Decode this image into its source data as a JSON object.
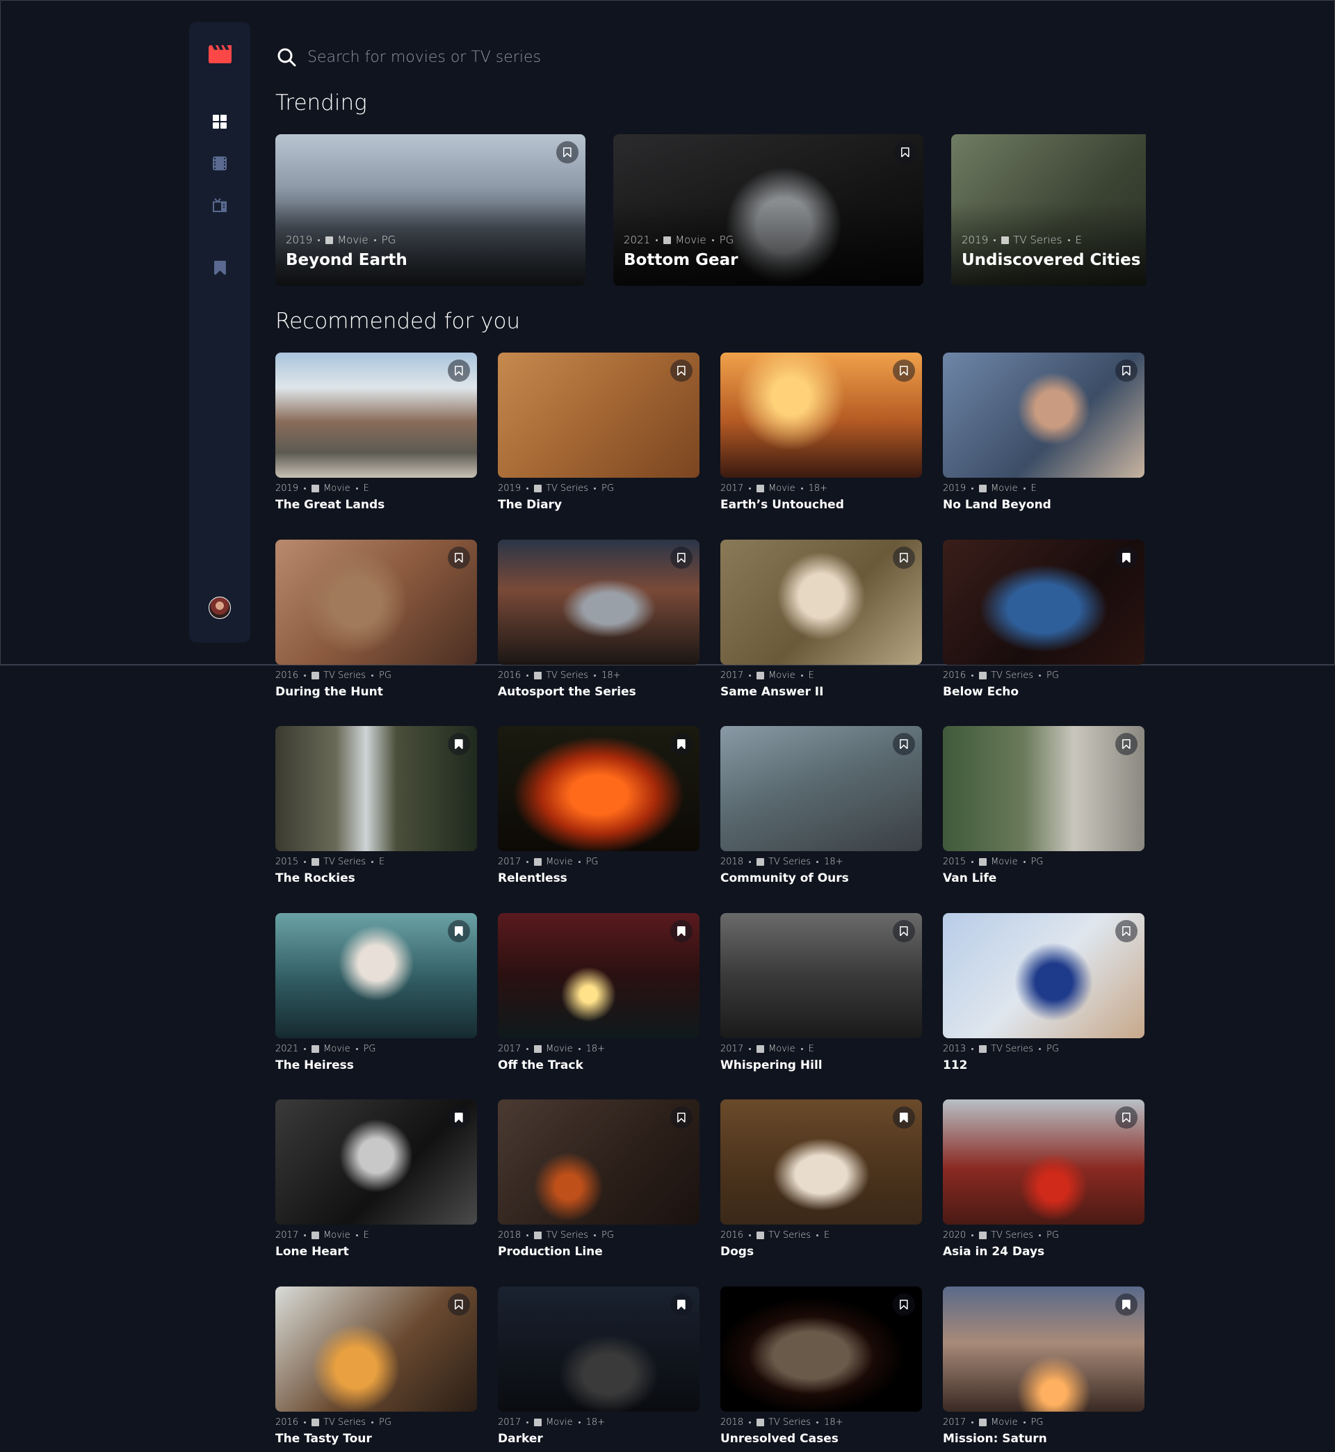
{
  "app": {
    "accent": "#fc4747"
  },
  "search": {
    "placeholder": "Search for movies or TV series"
  },
  "sections": {
    "trending": "Trending",
    "recommended": "Recommended for you"
  },
  "nav": [
    "home",
    "movies",
    "tv-series",
    "bookmarks"
  ],
  "trending": [
    {
      "year": "2019",
      "category": "Movie",
      "rating": "PG",
      "title": "Beyond Earth",
      "bookmarked": false,
      "thumb": "mountains"
    },
    {
      "year": "2021",
      "category": "Movie",
      "rating": "PG",
      "title": "Bottom Gear",
      "bookmarked": false,
      "thumb": "garage"
    },
    {
      "year": "2019",
      "category": "TV Series",
      "rating": "E",
      "title": "Undiscovered Cities",
      "bookmarked": false,
      "thumb": "car-interior"
    }
  ],
  "recommended": [
    {
      "year": "2019",
      "category": "Movie",
      "rating": "E",
      "title": "The Great Lands",
      "bookmarked": false,
      "thumb": "alps"
    },
    {
      "year": "2019",
      "category": "TV Series",
      "rating": "PG",
      "title": "The Diary",
      "bookmarked": false,
      "thumb": "desk"
    },
    {
      "year": "2017",
      "category": "Movie",
      "rating": "18+",
      "title": "Earth’s Untouched",
      "bookmarked": false,
      "thumb": "sunset"
    },
    {
      "year": "2019",
      "category": "Movie",
      "rating": "E",
      "title": "No Land Beyond",
      "bookmarked": false,
      "thumb": "portrait"
    },
    {
      "year": "2016",
      "category": "TV Series",
      "rating": "PG",
      "title": "During the Hunt",
      "bookmarked": false,
      "thumb": "deer"
    },
    {
      "year": "2016",
      "category": "TV Series",
      "rating": "18+",
      "title": "Autosport the Series",
      "bookmarked": false,
      "thumb": "bmw"
    },
    {
      "year": "2017",
      "category": "Movie",
      "rating": "E",
      "title": "Same Answer II",
      "bookmarked": false,
      "thumb": "woman"
    },
    {
      "year": "2016",
      "category": "TV Series",
      "rating": "PG",
      "title": "Below Echo",
      "bookmarked": true,
      "thumb": "cave"
    },
    {
      "year": "2015",
      "category": "TV Series",
      "rating": "E",
      "title": "The Rockies",
      "bookmarked": true,
      "thumb": "waterfall"
    },
    {
      "year": "2017",
      "category": "Movie",
      "rating": "PG",
      "title": "Relentless",
      "bookmarked": true,
      "thumb": "fire"
    },
    {
      "year": "2018",
      "category": "TV Series",
      "rating": "18+",
      "title": "Community of Ours",
      "bookmarked": false,
      "thumb": "street"
    },
    {
      "year": "2015",
      "category": "Movie",
      "rating": "PG",
      "title": "Van Life",
      "bookmarked": false,
      "thumb": "van"
    },
    {
      "year": "2021",
      "category": "Movie",
      "rating": "PG",
      "title": "The Heiress",
      "bookmarked": true,
      "thumb": "heiress"
    },
    {
      "year": "2017",
      "category": "Movie",
      "rating": "18+",
      "title": "Off the Track",
      "bookmarked": true,
      "thumb": "nightcar"
    },
    {
      "year": "2017",
      "category": "Movie",
      "rating": "E",
      "title": "Whispering Hill",
      "bookmarked": false,
      "thumb": "fog"
    },
    {
      "year": "2013",
      "category": "TV Series",
      "rating": "PG",
      "title": "112",
      "bookmarked": false,
      "thumb": "medical"
    },
    {
      "year": "2017",
      "category": "Movie",
      "rating": "E",
      "title": "Lone Heart",
      "bookmarked": true,
      "thumb": "bw-boy"
    },
    {
      "year": "2018",
      "category": "TV Series",
      "rating": "PG",
      "title": "Production Line",
      "bookmarked": false,
      "thumb": "pottery"
    },
    {
      "year": "2016",
      "category": "TV Series",
      "rating": "E",
      "title": "Dogs",
      "bookmarked": true,
      "thumb": "dog"
    },
    {
      "year": "2020",
      "category": "TV Series",
      "rating": "PG",
      "title": "Asia in 24 Days",
      "bookmarked": false,
      "thumb": "temple"
    },
    {
      "year": "2016",
      "category": "TV Series",
      "rating": "PG",
      "title": "The Tasty Tour",
      "bookmarked": false,
      "thumb": "food"
    },
    {
      "year": "2017",
      "category": "Movie",
      "rating": "18+",
      "title": "Darker",
      "bookmarked": true,
      "thumb": "dragon"
    },
    {
      "year": "2018",
      "category": "TV Series",
      "rating": "18+",
      "title": "Unresolved Cases",
      "bookmarked": false,
      "thumb": "window"
    },
    {
      "year": "2017",
      "category": "Movie",
      "rating": "PG",
      "title": "Mission: Saturn",
      "bookmarked": true,
      "thumb": "rocket"
    }
  ]
}
